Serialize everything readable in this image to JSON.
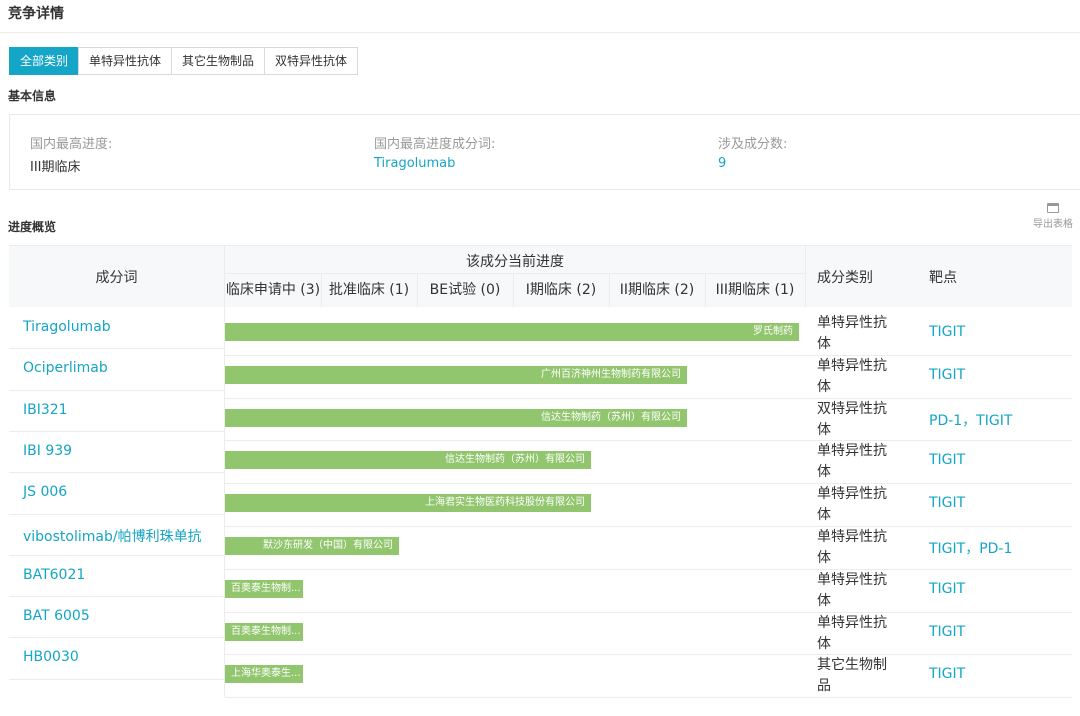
{
  "page_title": "竞争详情",
  "tabs": [
    {
      "label": "全部类别",
      "active": true
    },
    {
      "label": "单特异性抗体",
      "active": false
    },
    {
      "label": "其它生物制品",
      "active": false
    },
    {
      "label": "双特异性抗体",
      "active": false
    }
  ],
  "basic_info": {
    "section_title": "基本信息",
    "highest_progress_label": "国内最高进度:",
    "highest_progress_value": "III期临床",
    "highest_ingredient_label": "国内最高进度成分词:",
    "highest_ingredient_value": "Tiragolumab",
    "ingredient_count_label": "涉及成分数:",
    "ingredient_count_value": "9"
  },
  "overview": {
    "section_title": "进度概览",
    "export_label": "导出表格",
    "col_ingredient": "成分词",
    "col_progress_group": "该成分当前进度",
    "stages": [
      "临床申请中 (3)",
      "批准临床 (1)",
      "BE试验 (0)",
      "I期临床 (2)",
      "II期临床 (2)",
      "III期临床 (1)"
    ],
    "col_category": "成分类别",
    "col_target": "靶点"
  },
  "rows": [
    {
      "name": "Tiragolumab",
      "company": "罗氏制药",
      "stage_reached": 6,
      "category": "单特异性抗体",
      "target": "TIGIT"
    },
    {
      "name": "Ociperlimab",
      "company": "广州百济神州生物制药有限公司",
      "stage_reached": 5,
      "category": "单特异性抗体",
      "target": "TIGIT"
    },
    {
      "name": "IBI321",
      "company": "信达生物制药（苏州）有限公司",
      "stage_reached": 5,
      "category": "双特异性抗体",
      "target": "PD-1，TIGIT"
    },
    {
      "name": "IBI 939",
      "company": "信达生物制药（苏州）有限公司",
      "stage_reached": 4,
      "category": "单特异性抗体",
      "target": "TIGIT"
    },
    {
      "name": "JS 006",
      "company": "上海君实生物医药科技股份有限公司",
      "stage_reached": 4,
      "category": "单特异性抗体",
      "target": "TIGIT"
    },
    {
      "name": "vibostolimab/帕博利珠单抗",
      "company": "默沙东研发（中国）有限公司",
      "stage_reached": 2,
      "category": "单特异性抗体",
      "target": "TIGIT，PD-1"
    },
    {
      "name": "BAT6021",
      "company": "百奥泰生物制...",
      "stage_reached": 1,
      "category": "单特异性抗体",
      "target": "TIGIT"
    },
    {
      "name": "BAT 6005",
      "company": "百奥泰生物制...",
      "stage_reached": 1,
      "category": "单特异性抗体",
      "target": "TIGIT"
    },
    {
      "name": "HB0030",
      "company": "上海华奥泰生...",
      "stage_reached": 1,
      "category": "其它生物制品",
      "target": "TIGIT"
    }
  ],
  "colors": {
    "accent": "#15a5c6",
    "bar": "#91c66e",
    "header_bg": "#f7f8fa"
  }
}
